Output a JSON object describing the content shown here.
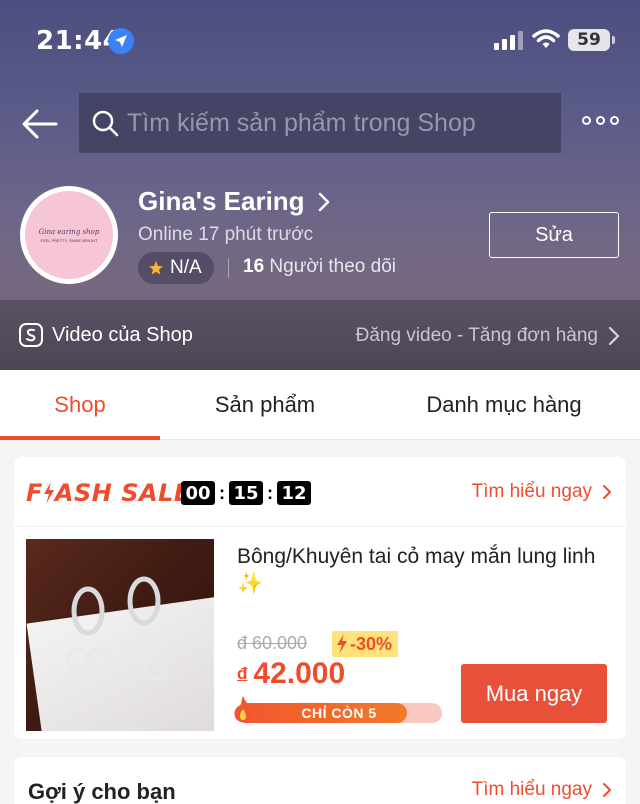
{
  "status_bar": {
    "time": "21:44",
    "battery": "59"
  },
  "header": {
    "search_placeholder": "Tìm kiếm sản phẩm trong Shop"
  },
  "shop": {
    "name": "Gina's Earing",
    "online_status": "Online 17 phút trước",
    "rating": "N/A",
    "followers_count": "16",
    "followers_label": " Người theo dõi",
    "edit_label": "Sửa",
    "avatar_text": {
      "line1": "Gina earing shop",
      "line2": "FEEL PRETTY, SHINE BRIGHT"
    }
  },
  "video_row": {
    "left_label": "Video của Shop",
    "right_label": "Đăng video - Tăng đơn hàng"
  },
  "tabs": [
    {
      "label": "Shop",
      "active": true
    },
    {
      "label": "Sản phẩm",
      "active": false
    },
    {
      "label": "Danh mục hàng",
      "active": false
    }
  ],
  "flash_sale": {
    "title_part1": "F",
    "title_part2": "ASH",
    "title_part3": " SALE",
    "timer": {
      "hours": "00",
      "minutes": "15",
      "seconds": "12"
    },
    "more_label": "Tìm hiểu ngay",
    "product": {
      "name": "Bông/Khuyên tai cỏ may mắn lung linh ✨",
      "old_price": "đ 60.000",
      "discount": "-30%",
      "currency": "đ",
      "price": "42.000",
      "stock_label": "CHỈ CÒN 5",
      "stock_fraction": 0.83,
      "buy_label": "Mua ngay"
    }
  },
  "suggest": {
    "title": "Gợi ý cho bạn",
    "more_label": "Tìm hiểu ngay"
  },
  "colors": {
    "accent": "#ee4d2d",
    "buy_button": "#e9503a",
    "discount_bg": "#ffe27a"
  }
}
